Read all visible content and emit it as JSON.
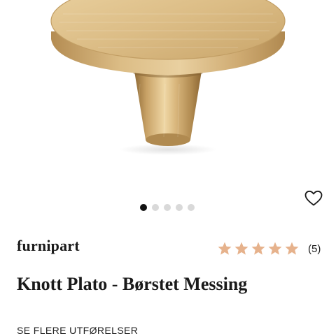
{
  "product": {
    "brand": "furnipart",
    "title": "Knott Plato - Børstet Messing",
    "rating": {
      "value": 5,
      "max": 5,
      "count_label": "(5)"
    },
    "see_more_label": "SE FLERE UTFØRELSER"
  },
  "gallery": {
    "image_count": 5,
    "active_index": 0
  },
  "icons": {
    "favorite": "heart-outline-icon",
    "rating": "star-icon"
  },
  "colors": {
    "brass_light": "#e2c68f",
    "brass_mid": "#c9a56a",
    "brass_dark": "#a37f45",
    "star": "#e6b28c",
    "dot_active": "#111111",
    "dot_inactive": "#d9d9d9",
    "text": "#1a1a1a"
  }
}
